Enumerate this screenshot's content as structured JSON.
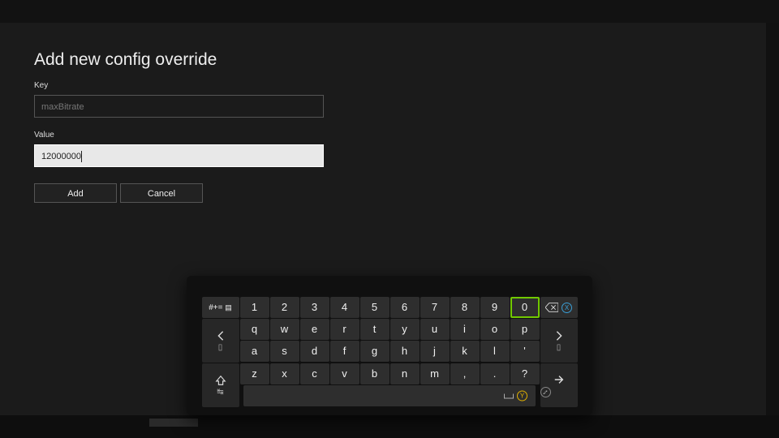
{
  "title": "Add new config override",
  "fields": {
    "key": {
      "label": "Key",
      "value": "maxBitrate"
    },
    "value": {
      "label": "Value",
      "value": "12000000"
    }
  },
  "buttons": {
    "add": "Add",
    "cancel": "Cancel"
  },
  "keyboard": {
    "symbolKey": "#+=",
    "row0": [
      "1",
      "2",
      "3",
      "4",
      "5",
      "6",
      "7",
      "8",
      "9",
      "0"
    ],
    "row1": [
      "q",
      "w",
      "e",
      "r",
      "t",
      "y",
      "u",
      "i",
      "o",
      "p"
    ],
    "row2": [
      "a",
      "s",
      "d",
      "f",
      "g",
      "h",
      "j",
      "k",
      "l",
      "'"
    ],
    "row3": [
      "z",
      "x",
      "c",
      "v",
      "b",
      "n",
      "m",
      ",",
      ".",
      "?"
    ],
    "focusedKey": "0",
    "hints": {
      "x": "X",
      "y": "Y",
      "b": "B"
    }
  }
}
